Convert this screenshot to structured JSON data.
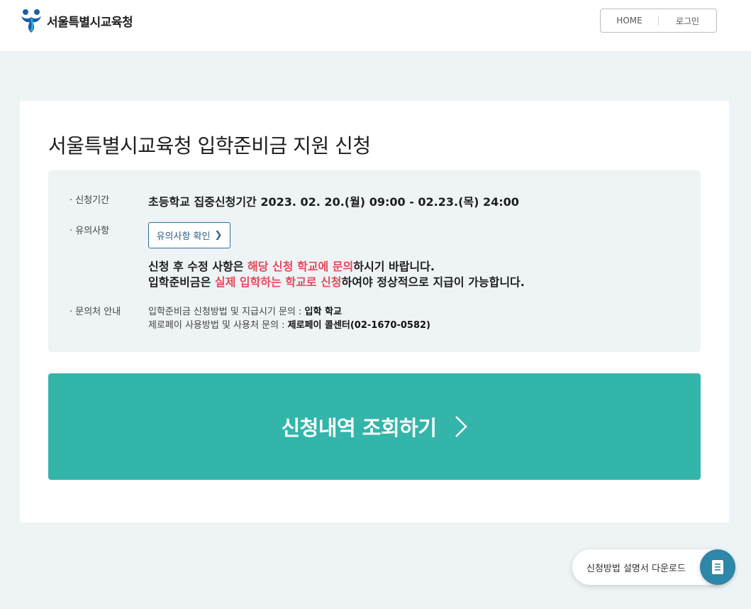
{
  "header": {
    "logo_text": "서울특별시교육청",
    "nav": {
      "home": "HOME",
      "login": "로그인"
    }
  },
  "main": {
    "title": "서울특별시교육청 입학준비금 지원 신청",
    "period": {
      "label": "· 신청기간",
      "value": "초등학교 집중신청기간 2023. 02. 20.(월) 09:00 - 02.23.(목) 24:00"
    },
    "notice": {
      "label": "· 유의사항",
      "button_label": "유의사항 확인",
      "line1": {
        "a": "신청 후 수정 사항은 ",
        "highlight": "해당 신청 학교에 문의",
        "b": "하시기 바랍니다."
      },
      "line2": {
        "a": "입학준비금은 ",
        "highlight": "실제 입학하는 학교로 신청",
        "b": "하여야 정상적으로 지급이 가능합니다."
      }
    },
    "contact": {
      "label": "· 문의처 안내",
      "line1": {
        "text": "입학준비금 신청방법 및 지급시기 문의 : ",
        "bold": "입학 학교"
      },
      "line2": {
        "text": "제로페이 사용방법 및 사용처 문의 : ",
        "bold": "제로페이 콜센터(02-1670-0582)"
      }
    },
    "lookup_button": "신청내역 조회하기"
  },
  "floating": {
    "download_label": "신청방법 설명서 다운로드",
    "icon": "document-icon"
  },
  "colors": {
    "accent": "#33b5aa",
    "highlight": "#e5485b",
    "link_border": "#2e6f9c",
    "download_icon_bg": "#2e86a8"
  }
}
